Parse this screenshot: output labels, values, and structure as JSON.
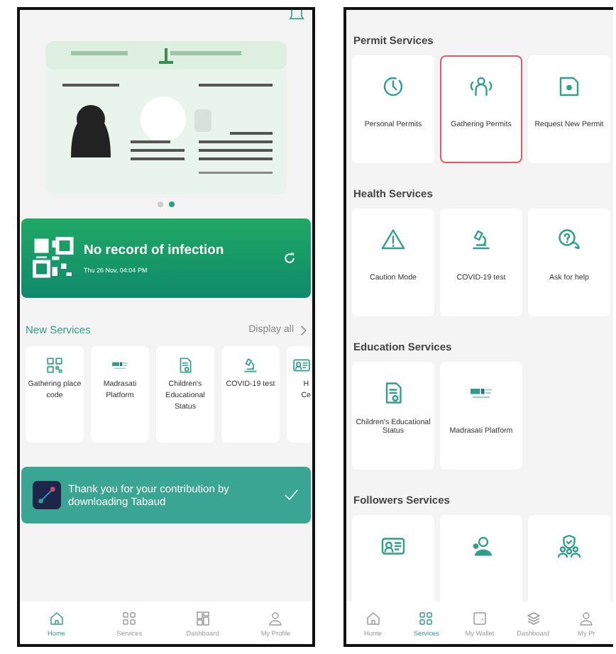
{
  "home_screen": {
    "carousel_dots": [
      {
        "selected": false
      },
      {
        "selected": true
      }
    ],
    "health_status": {
      "title": "No record of infection",
      "time": "Thu 26 Nov, 04:04 PM"
    },
    "new_services": {
      "title": "New Services",
      "link": "Display all",
      "items": [
        {
          "label": "Gathering place code"
        },
        {
          "label": "Madrasati Platform"
        },
        {
          "label": "Children's Educational Status"
        },
        {
          "label": "COVID-19 test"
        },
        {
          "label": "H\nCe"
        }
      ]
    },
    "banner": {
      "text": "Thank you for your contribution by downloading Tabaud"
    },
    "nav": [
      {
        "label": "Home",
        "selected": true
      },
      {
        "label": "Services",
        "selected": false
      },
      {
        "label": "Dashboard",
        "selected": false
      },
      {
        "label": "My Profile",
        "selected": false
      }
    ]
  },
  "services_screen": {
    "sections": [
      {
        "title": "Permit Services",
        "items": [
          {
            "label": "Personal Permits",
            "selected": false
          },
          {
            "label": "Gathering Permits",
            "selected": true
          },
          {
            "label": "Request New Permit",
            "selected": false
          }
        ]
      },
      {
        "title": "Health Services",
        "items": [
          {
            "label": "Caution Mode",
            "selected": false
          },
          {
            "label": "COVID-19 test",
            "selected": false
          },
          {
            "label": "Ask for help",
            "selected": false
          }
        ]
      },
      {
        "title": "Education Services",
        "items": [
          {
            "label": "Children's Educational Status",
            "selected": false
          },
          {
            "label": "Madrasati Platform",
            "selected": false
          }
        ]
      },
      {
        "title": "Followers Services",
        "items": [
          {
            "selected": false
          },
          {
            "selected": false
          },
          {
            "selected": false
          }
        ]
      }
    ],
    "nav": [
      {
        "label": "Home",
        "selected": false
      },
      {
        "label": "Services",
        "selected": true
      },
      {
        "label": "My Wallet",
        "selected": false
      },
      {
        "label": "Dashboard",
        "selected": false
      },
      {
        "label": "My Pr",
        "selected": false
      }
    ]
  }
}
